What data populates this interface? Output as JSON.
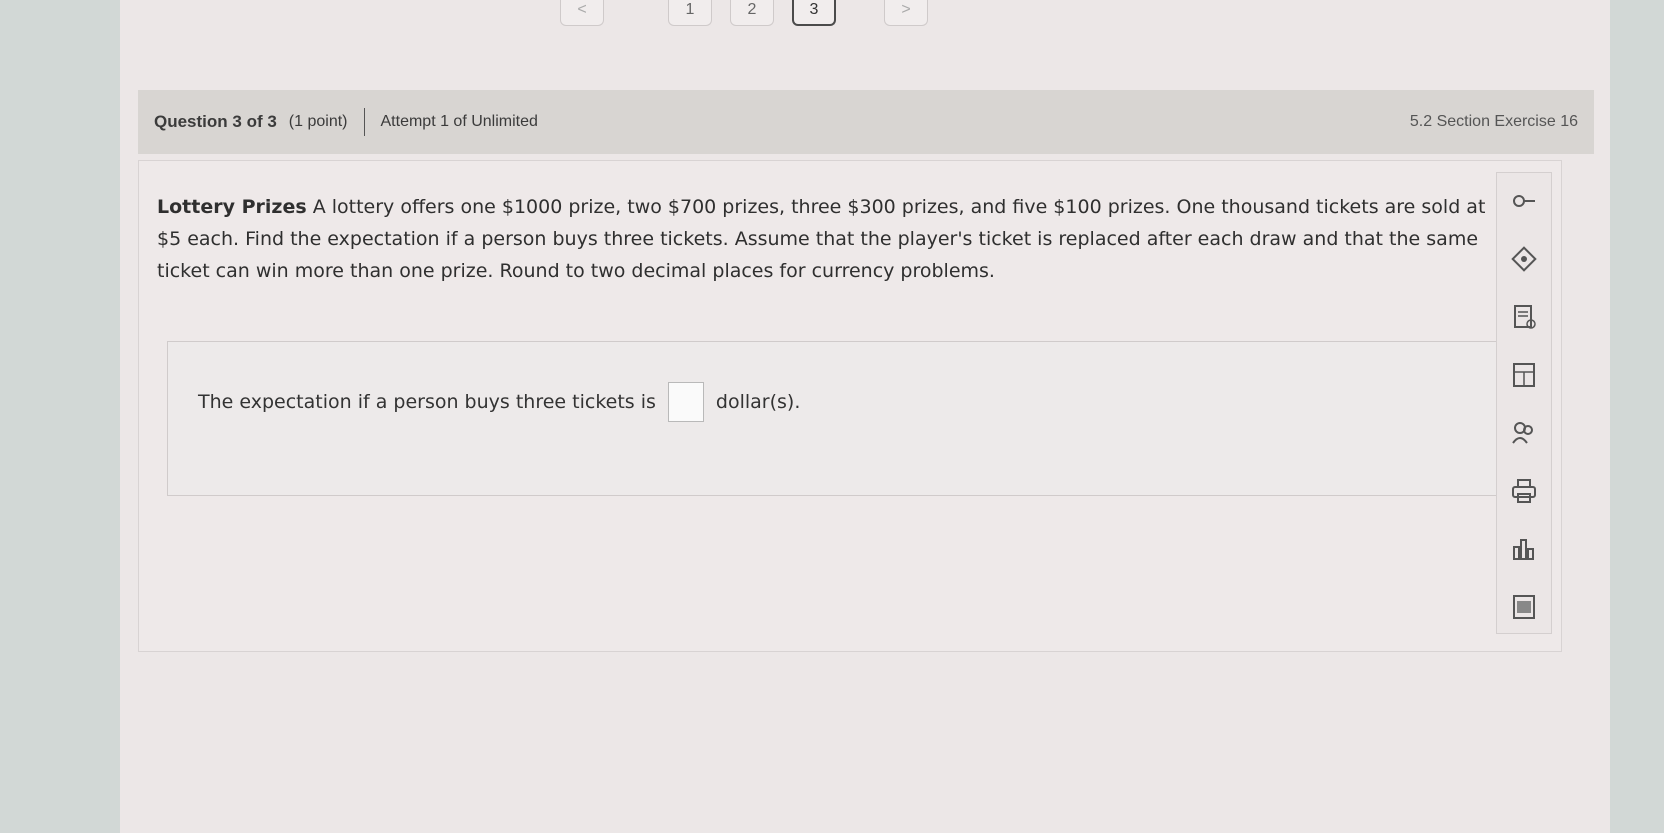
{
  "pager": {
    "prev": "<",
    "pages": [
      "1",
      "2",
      "3"
    ],
    "next": ">",
    "current_index": 2
  },
  "header": {
    "question_label": "Question 3 of 3",
    "points": "(1 point)",
    "attempt": "Attempt 1 of Unlimited",
    "section": "5.2 Section Exercise 16"
  },
  "problem": {
    "title": "Lottery Prizes",
    "text": "A lottery offers one $1000 prize, two $700 prizes, three $300 prizes, and five $100 prizes. One thousand tickets are sold at $5 each. Find the expectation if a person buys three tickets. Assume that the player's ticket is replaced after each draw and that the same ticket can win more than one prize. Round to two decimal places for currency problems."
  },
  "answer": {
    "prefix": "The expectation if a person buys three tickets is",
    "value": "",
    "suffix": "dollar(s)."
  },
  "toolbar": {
    "items": [
      "key-icon",
      "hint-icon",
      "ebook-icon",
      "calculator-icon",
      "help-people-icon",
      "print-icon",
      "chart-icon",
      "video-icon"
    ]
  },
  "colors": {
    "page_bg": "#ece7e7",
    "header_bg": "#d8d5d2",
    "outer_bg": "#d2d8d6"
  }
}
